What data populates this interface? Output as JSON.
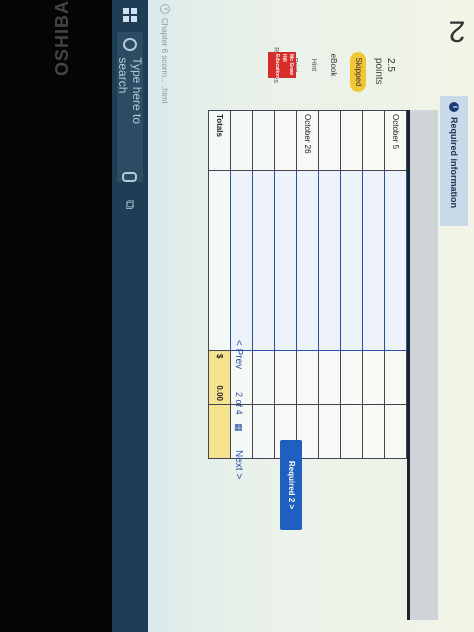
{
  "device": {
    "brand": "OSHIBA"
  },
  "header": {
    "question_number": "2"
  },
  "sidebar": {
    "points_value": "2.5",
    "points_label": "points",
    "status_badge": "Skipped",
    "links": [
      "eBook",
      "Hint",
      "Print",
      "References"
    ],
    "logo_text": "Mc Graw Hill Education"
  },
  "tabs": {
    "required_info": "Required information",
    "info_symbol": "i"
  },
  "table": {
    "rows": [
      {
        "date": "October 5",
        "account": "",
        "debit": "",
        "credit": ""
      },
      {
        "date": "",
        "account": "",
        "debit": "",
        "credit": ""
      },
      {
        "date": "",
        "account": "",
        "debit": "",
        "credit": ""
      },
      {
        "date": "",
        "account": "",
        "debit": "",
        "credit": ""
      },
      {
        "date": "October 26",
        "account": "",
        "debit": "",
        "credit": ""
      },
      {
        "date": "",
        "account": "",
        "debit": "",
        "credit": ""
      },
      {
        "date": "",
        "account": "",
        "debit": "",
        "credit": ""
      },
      {
        "date": "",
        "account": "",
        "debit": "",
        "credit": ""
      }
    ],
    "totals_label": "Totals",
    "totals_currency": "$",
    "totals_amount": "0.00"
  },
  "navigation": {
    "required_2_button": "Required 2  >",
    "prev_label": "< Prev",
    "page_current": "2",
    "page_of": "of",
    "page_total": "4",
    "next_label": "Next  >"
  },
  "taskbar": {
    "search_placeholder": "Type here to search",
    "chapter_tab": "Chapter 6 scorm... .html"
  }
}
